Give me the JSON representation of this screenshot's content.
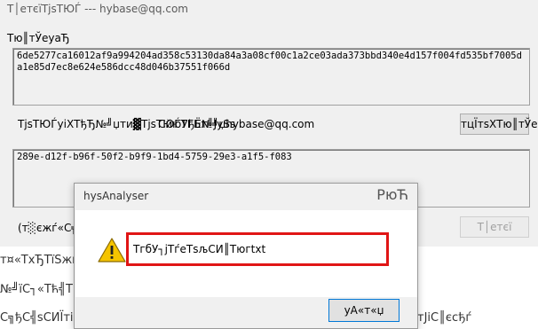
{
  "background_doc": {
    "line1": "т¤«ТхЂТїЅжюђжЁЇуй«",
    "line2": "№╝їС┐«Тћ╣ТЌХжЌ┤жЌ┤",
    "line3": "С╗ђС╣ѕСИЇтіаСИі ES",
    "line3_tail": "тЈіС║єсђѓ"
  },
  "main_window": {
    "title": "Т│етєїТјѕТЮЃ --- hybase@qq.com",
    "machine_code_label": "Тю║тЎеуаЂ",
    "machine_code": "6de5277ca16012af9a994204ad358c53130da84a3a08cf00c1a2ce03ada373bbd340e4d157f004fd535bf7005da1e85d7ec8e624e586dcc48d046b37551f066d",
    "status_label": "ТјѕТЮЃуіХТђЂ№╝џти▓ТјѕТЮЃТГБт╝ЈуЅѕ",
    "author_label": "СйюУђЁ№╝џhybase@qq.com",
    "copy_button": "тцЇтѕХТю║тЎеуаЂ",
    "license_key": "289e-d12f-b96f-50f2-b9f9-1bd4-5759-29e3-a1f5-f083",
    "hint_text": "(т░єжѓ«С╗Хтъ«тцЇ",
    "register_button": "Т│етєї"
  },
  "dialog": {
    "title": "hysAnalyser",
    "close_glyph": "РюЋ",
    "icon": "warning-icon",
    "message": "ТгбУ┐јТѓеТѕљСИ║Тюгtxt",
    "ok_button": "уА«т«џ"
  },
  "colors": {
    "highlight_border": "#e01515",
    "warning_yellow": "#f5c400",
    "focus_blue": "#0078d7"
  }
}
